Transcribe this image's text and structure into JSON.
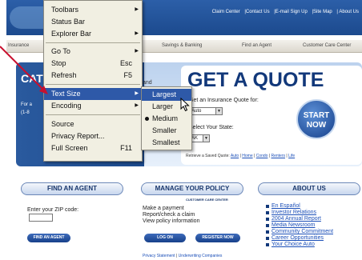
{
  "site": {
    "top_links": [
      "Claim Center",
      "|Contact Us",
      "|E-mail Sign Up",
      "|Site Map",
      "| About Us"
    ],
    "nav_items": [
      "Insurance",
      "Savings & Banking",
      "Find an Agent",
      "Customer Care Center"
    ],
    "promo": {
      "heading": "CAT",
      "for_text": "For a",
      "phone_text": "(1-8",
      "and_text": "and"
    }
  },
  "quote": {
    "title": "GET A QUOTE",
    "insurance_label": "Get an Insurance Quote for:",
    "insurance_value": "Auto",
    "state_label": "Select Your State:",
    "state_value": "AK",
    "saved_prefix": "Retrieve a Saved Quote:",
    "saved_links": [
      "Auto",
      "Home",
      "Condo",
      "Renters",
      "Life"
    ],
    "start_button": "START NOW"
  },
  "panels": {
    "find_agent": {
      "title": "FIND AN AGENT",
      "zip_label": "Enter your ZIP code:",
      "zip_value": "",
      "button": "FIND AN AGENT"
    },
    "manage": {
      "title": "MANAGE YOUR POLICY",
      "subtitle": "CUSTOMER CARE CENTER",
      "lines": [
        "Make a payment",
        "Report/check a claim",
        "View policy information"
      ],
      "login_button": "LOG ON",
      "register_button": "REGISTER NOW",
      "privacy_link": "Privacy Statement",
      "underwriting_link": "Underwriting Companies"
    },
    "about": {
      "title": "ABOUT US",
      "links": [
        "En Español",
        "Investor Relations",
        "2004 Annual Report",
        "Media Newsroom",
        "Community Commitment",
        "Career Opportunities",
        "Your Choice Auto"
      ]
    }
  },
  "view_menu": {
    "items": [
      {
        "label": "Toolbars",
        "shortcut": "",
        "has_submenu": true
      },
      {
        "label": "Status Bar",
        "shortcut": "",
        "has_submenu": false
      },
      {
        "label": "Explorer Bar",
        "shortcut": "",
        "has_submenu": true
      },
      {
        "label": "Go To",
        "shortcut": "",
        "has_submenu": true
      },
      {
        "label": "Stop",
        "shortcut": "Esc",
        "has_submenu": false
      },
      {
        "label": "Refresh",
        "shortcut": "F5",
        "has_submenu": false
      },
      {
        "label": "Text Size",
        "shortcut": "",
        "has_submenu": true,
        "highlighted": true
      },
      {
        "label": "Encoding",
        "shortcut": "",
        "has_submenu": true
      },
      {
        "label": "Source",
        "shortcut": "",
        "has_submenu": false
      },
      {
        "label": "Privacy Report...",
        "shortcut": "",
        "has_submenu": false
      },
      {
        "label": "Full Screen",
        "shortcut": "F11",
        "has_submenu": false
      }
    ]
  },
  "text_size_menu": {
    "items": [
      "Largest",
      "Larger",
      "Medium",
      "Smaller",
      "Smallest"
    ],
    "highlighted": "Largest",
    "selected": "Medium"
  },
  "colors": {
    "menu_bg": "#f1efe2",
    "menu_highlight": "#2e59a8",
    "brand_blue": "#12387a",
    "annotation_arrow": "#c8102e"
  },
  "icons": [
    "submenu-arrow-icon",
    "radio-dot-icon",
    "mouse-pointer-icon",
    "annotation-arrow-icon"
  ]
}
